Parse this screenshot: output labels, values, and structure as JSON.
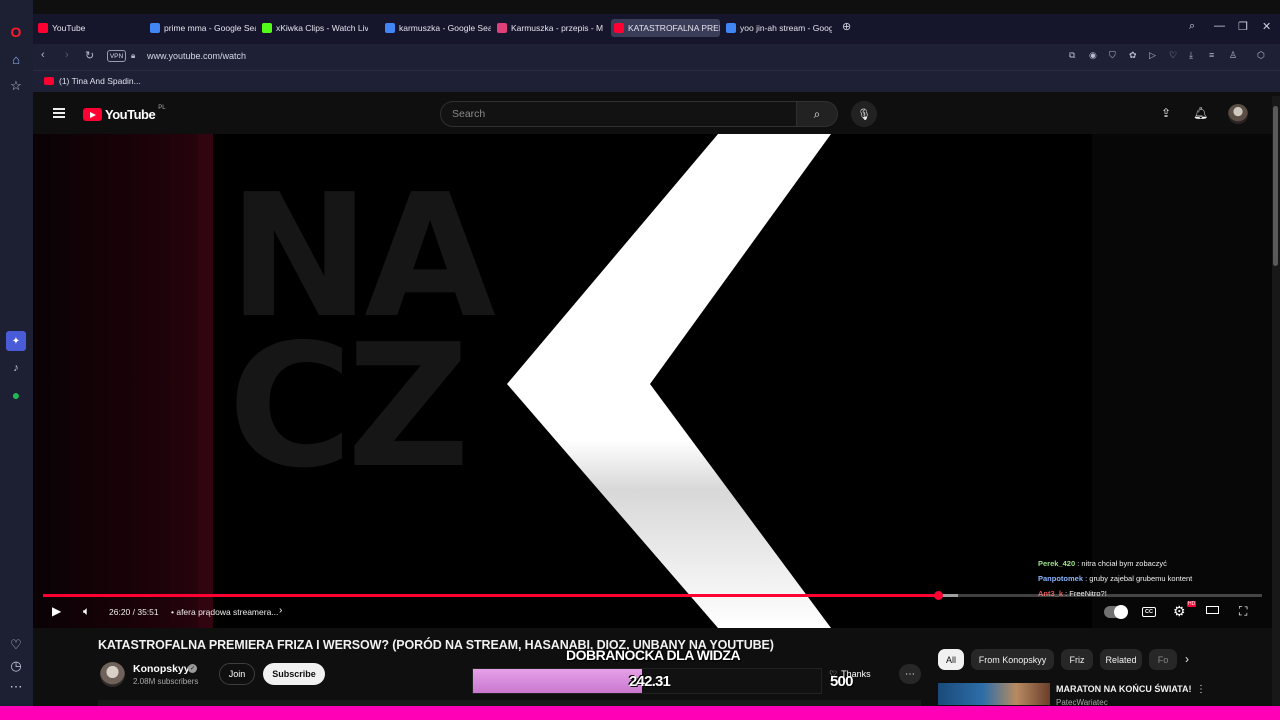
{
  "browser": {
    "tabs": [
      {
        "label": "YouTube",
        "color": "#ff0033"
      },
      {
        "label": "prime mma - Google Sear",
        "color": "#4285f4"
      },
      {
        "label": "xKiwka Clips - Watch Live",
        "color": "#53fc18"
      },
      {
        "label": "karmuszka - Google Sear",
        "color": "#4285f4"
      },
      {
        "label": "Karmuszka - przepis - Mo",
        "color": "#e0407a"
      },
      {
        "label": "KATASTROFALNA PREMIE",
        "color": "#ff0033"
      },
      {
        "label": "yoo jin-ah stream - Goog",
        "color": "#4285f4"
      }
    ],
    "url": "www.youtube.com/watch",
    "vpn_label": "VPN",
    "bookmark": "(1) Tina And Spadin..."
  },
  "youtube": {
    "logo": "YouTube",
    "country": "PL",
    "search_placeholder": "Search"
  },
  "player": {
    "time": "26:20 / 35:51",
    "chapter": "• afera prądowa streamera...",
    "progress_fraction": 0.734,
    "buffer_fraction": 0.751,
    "hd_badge": "HD",
    "cc_label": "CC",
    "chat": [
      {
        "user": "Perek_420",
        "message": " : nitra chciał bym zobaczyć",
        "color": "#9ee08a"
      },
      {
        "user": "Panpotomek",
        "message": " : gruby zajebal grubemu kontent",
        "color": "#8ab4ff"
      },
      {
        "user": "Ant3_k",
        "message": " : FreeNitro?!",
        "color": "#e05050"
      }
    ]
  },
  "video_info": {
    "title": "KATASTROFALNA PREMIERA FRIZA I WERSOW? (PORÓD NA STREAM, HASANABI, DIOZ, UNBANY NA YOUTUBE)",
    "channel": "Konopskyy",
    "subscribers": "2.08M subscribers",
    "join": "Join",
    "subscribe": "Subscribe",
    "thanks": "Thanks"
  },
  "stream_overlay": {
    "label": "DOBRANOCKA DLA WIDZA",
    "value": "242.31",
    "target": "500",
    "fill_fraction": 0.4846
  },
  "sidebar_chips": [
    "All",
    "From Konopskyy",
    "Friz",
    "Related",
    "Fo"
  ],
  "recommendation": {
    "title": "MARATON NA KOŃCU ŚWIATA!",
    "channel": "PatecWariatec"
  }
}
